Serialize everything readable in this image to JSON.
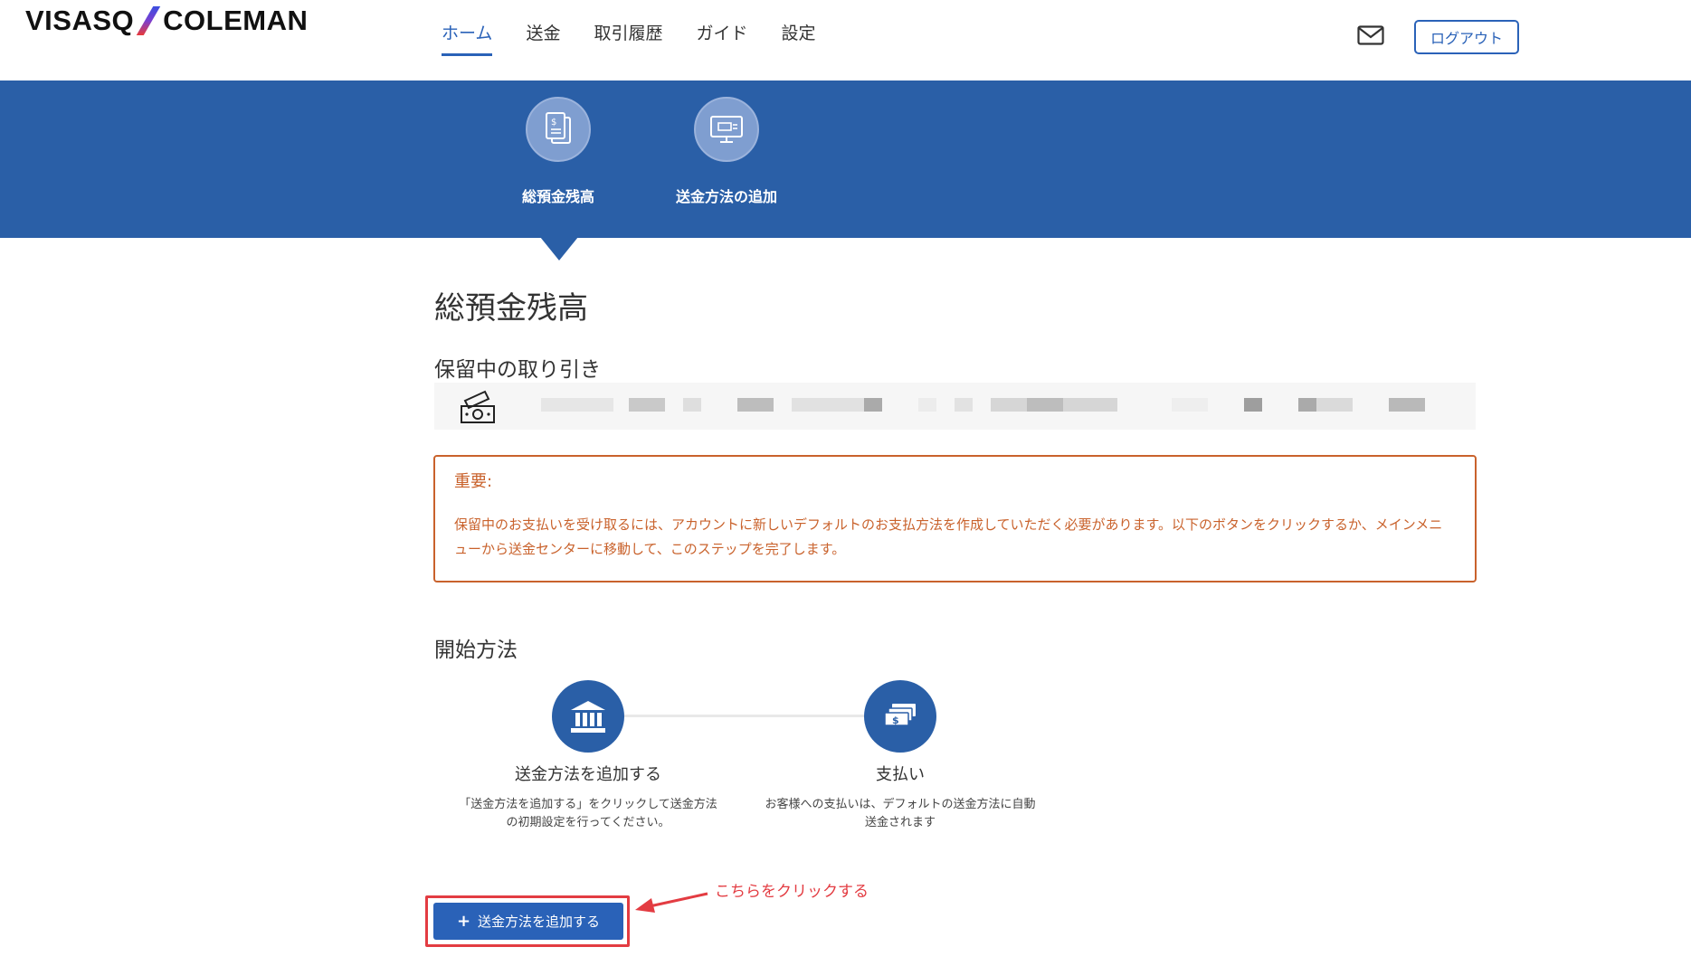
{
  "header": {
    "logo_left": "VISASQ",
    "logo_right": "COLEMAN",
    "nav": [
      {
        "label": "ホーム",
        "active": true
      },
      {
        "label": "送金",
        "active": false
      },
      {
        "label": "取引履歴",
        "active": false
      },
      {
        "label": "ガイド",
        "active": false
      },
      {
        "label": "設定",
        "active": false
      }
    ],
    "mail_icon": "mail-icon",
    "logout_label": "ログアウト"
  },
  "banner": {
    "tabs": [
      {
        "label": "総預金残高",
        "icon": "document-dollar-icon",
        "active": true
      },
      {
        "label": "送金方法の追加",
        "icon": "monitor-icon",
        "active": false
      }
    ]
  },
  "main": {
    "title": "総預金残高",
    "pending": {
      "heading": "保留中の取り引き",
      "icon": "cash-icon"
    },
    "notice": {
      "title": "重要:",
      "body": "保留中のお支払いを受け取るには、アカウントに新しいデフォルトのお支払方法を作成していただく必要があります。以下のボタンをクリックするか、メインメニューから送金センターに移動して、このステップを完了します。"
    },
    "steps": {
      "heading": "開始方法",
      "items": [
        {
          "icon": "bank-icon",
          "title": "送金方法を追加する",
          "desc": "「送金方法を追加する」をクリックして送金方法の初期設定を行ってください。"
        },
        {
          "icon": "money-icon",
          "title": "支払い",
          "desc": "お客様への支払いは、デフォルトの送金方法に自動送金されます"
        }
      ]
    },
    "add_button": {
      "label": "送金方法を追加する",
      "icon": "plus-icon"
    },
    "annotation": {
      "text": "こちらをクリックする",
      "color": "#e33c42"
    }
  },
  "colors": {
    "brand_blue": "#2a5fa7",
    "link_blue": "#2a62b8",
    "warning_orange": "#c9622c"
  }
}
